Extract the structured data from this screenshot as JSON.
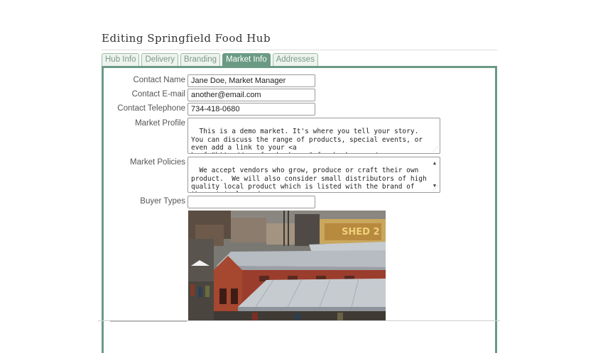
{
  "page": {
    "title": "Editing Springfield Food Hub"
  },
  "tabs": [
    {
      "label": "Hub Info",
      "active": false
    },
    {
      "label": "Delivery",
      "active": false
    },
    {
      "label": "Branding",
      "active": false
    },
    {
      "label": "Market Info",
      "active": true
    },
    {
      "label": "Addresses",
      "active": false
    }
  ],
  "form": {
    "contact_name": {
      "label": "Contact Name",
      "value": "Jane Doe, Market Manager"
    },
    "contact_email": {
      "label": "Contact E-mail",
      "value": "another@email.com"
    },
    "contact_telephone": {
      "label": "Contact Telephone",
      "value": "734-418-0680"
    },
    "market_profile": {
      "label": "Market Profile",
      "value": "This is a demo market. It's where you tell your story.  You can discuss the range of products, special events, or even add a link to your <a href=\"http://www.facebook.com\">facebook page</a>."
    },
    "market_policies": {
      "label": "Market Policies",
      "value": "We accept vendors who grow, produce or craft their own product.  We will also consider small distributors of high quality local product which is listed with the brand of the original producer."
    },
    "buyer_types": {
      "label": "Buyer Types",
      "value": ""
    }
  },
  "photo": {
    "sign_text": "SHED 2"
  },
  "colors": {
    "accent": "#6a9a84",
    "tab_inactive_text": "#7b9a87",
    "tab_border": "#9bbda8"
  }
}
